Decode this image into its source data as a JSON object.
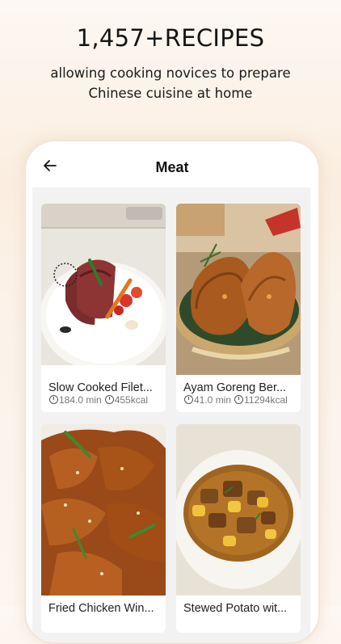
{
  "promo": {
    "headline": "1,457+RECIPES",
    "line1": "allowing cooking novices to prepare",
    "line2": "Chinese cuisine at home"
  },
  "appbar": {
    "title": "Meat"
  },
  "recipes": [
    {
      "name": "Slow Cooked Filet...",
      "time": "184.0 min",
      "kcal": "455kcal"
    },
    {
      "name": "Ayam Goreng Ber...",
      "time": "41.0 min",
      "kcal": "11294kcal"
    },
    {
      "name": "Fried Chicken Win...",
      "time": "",
      "kcal": ""
    },
    {
      "name": "Stewed Potato wit...",
      "time": "",
      "kcal": ""
    }
  ]
}
